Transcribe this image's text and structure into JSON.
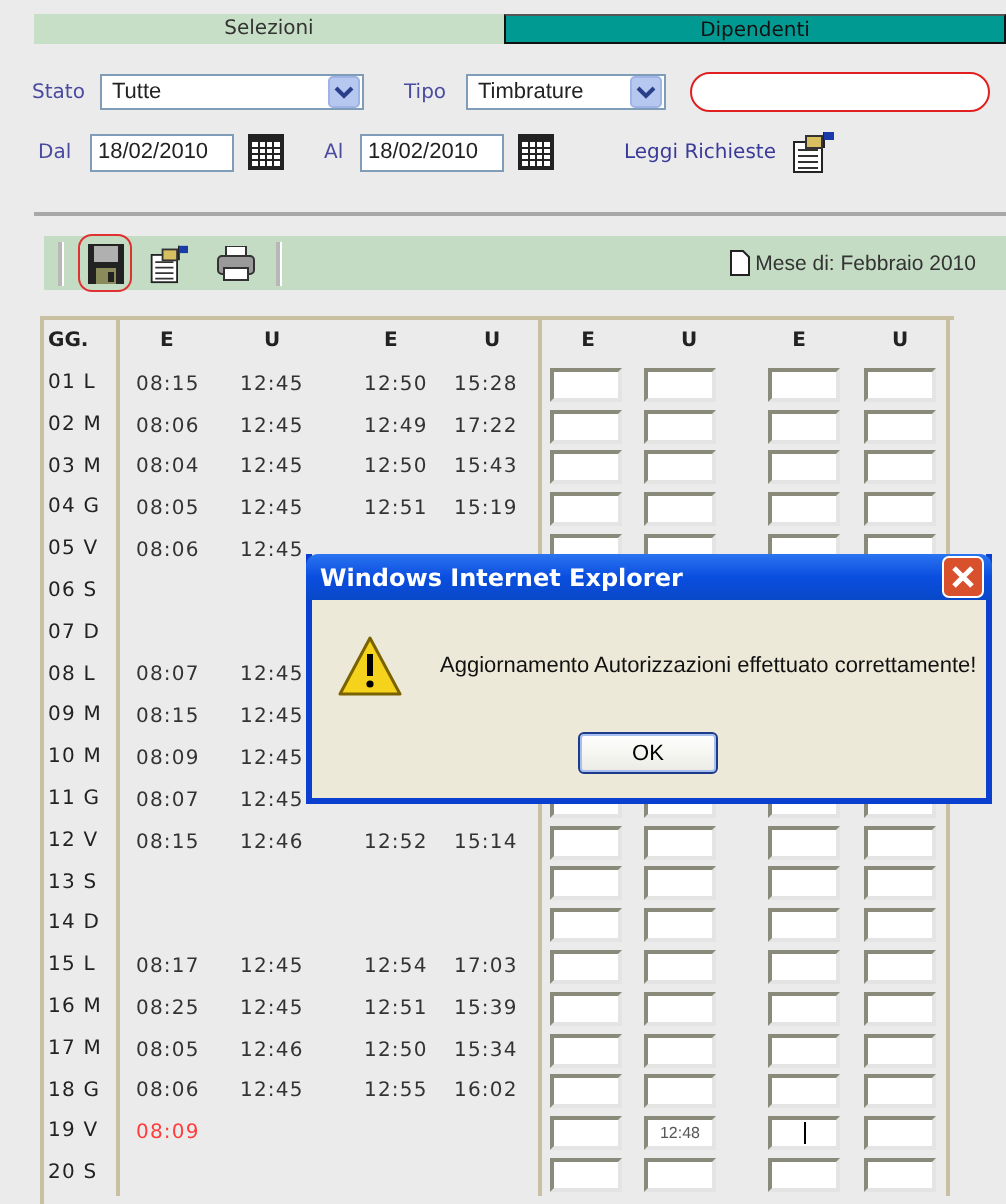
{
  "tabs": [
    {
      "label": "Selezioni",
      "selected": true
    },
    {
      "label": "Dipendenti",
      "selected": false
    }
  ],
  "filters": {
    "stato_label": "Stato",
    "stato_value": "Tutte",
    "tipo_label": "Tipo",
    "tipo_value": "Timbrature",
    "dal_label": "Dal",
    "dal_value": "18/02/2010",
    "al_label": "Al",
    "al_value": "18/02/2010",
    "leggi_link": "Leggi Richieste"
  },
  "toolbar": {
    "month": "Mese di: Febbraio 2010"
  },
  "table": {
    "columns": [
      "GG.",
      "E",
      "U",
      "E",
      "U",
      "E",
      "U",
      "E",
      "U"
    ],
    "rows": [
      {
        "day": "01 L",
        "times": [
          {
            "text": "08:15",
            "late": false
          },
          {
            "text": "12:45",
            "late": false
          },
          {
            "text": "12:50",
            "late": false
          },
          {
            "text": "15:28",
            "late": false
          }
        ],
        "inputs": [
          {
            "focused": false
          },
          {
            "focused": false
          },
          {
            "focused": false
          },
          {
            "focused": false
          }
        ]
      },
      {
        "day": "02 M",
        "times": [
          {
            "text": "08:06",
            "late": false
          },
          {
            "text": "12:45",
            "late": false
          },
          {
            "text": "12:49",
            "late": false
          },
          {
            "text": "17:22",
            "late": false
          }
        ],
        "inputs": [
          {
            "focused": false
          },
          {
            "focused": false
          },
          {
            "focused": false
          },
          {
            "focused": false
          }
        ]
      },
      {
        "day": "03 M",
        "times": [
          {
            "text": "08:04",
            "late": false
          },
          {
            "text": "12:45",
            "late": false
          },
          {
            "text": "12:50",
            "late": false
          },
          {
            "text": "15:43",
            "late": false
          }
        ],
        "inputs": [
          {
            "focused": false
          },
          {
            "focused": false
          },
          {
            "focused": false
          },
          {
            "focused": false
          }
        ]
      },
      {
        "day": "04 G",
        "times": [
          {
            "text": "08:05",
            "late": false
          },
          {
            "text": "12:45",
            "late": false
          },
          {
            "text": "12:51",
            "late": false
          },
          {
            "text": "15:19",
            "late": false
          }
        ],
        "inputs": [
          {
            "focused": false
          },
          {
            "focused": false
          },
          {
            "focused": false
          },
          {
            "focused": false
          }
        ]
      },
      {
        "day": "05 V",
        "times": [
          {
            "text": "08:06",
            "late": false
          },
          {
            "text": "12:45",
            "late": false
          }
        ],
        "inputs": [
          {
            "focused": false
          },
          {
            "focused": false
          },
          {
            "focused": false
          },
          {
            "focused": false
          }
        ]
      },
      {
        "day": "06 S",
        "times": [],
        "inputs": []
      },
      {
        "day": "07 D",
        "times": [],
        "inputs": []
      },
      {
        "day": "08 L",
        "times": [
          {
            "text": "08:07",
            "late": false
          },
          {
            "text": "12:45",
            "late": false
          }
        ],
        "inputs": []
      },
      {
        "day": "09 M",
        "times": [
          {
            "text": "08:15",
            "late": false
          },
          {
            "text": "12:45",
            "late": false
          }
        ],
        "inputs": []
      },
      {
        "day": "10 M",
        "times": [
          {
            "text": "08:09",
            "late": false
          },
          {
            "text": "12:45",
            "late": false
          }
        ],
        "inputs": []
      },
      {
        "day": "11 G",
        "times": [
          {
            "text": "08:07",
            "late": false
          },
          {
            "text": "12:45",
            "late": false
          }
        ],
        "inputs": [
          {
            "focused": false
          },
          {
            "focused": false
          },
          {
            "focused": false
          },
          {
            "focused": false
          }
        ]
      },
      {
        "day": "12 V",
        "times": [
          {
            "text": "08:15",
            "late": false
          },
          {
            "text": "12:46",
            "late": false
          },
          {
            "text": "12:52",
            "late": false
          },
          {
            "text": "15:14",
            "late": false
          }
        ],
        "inputs": [
          {
            "focused": false
          },
          {
            "focused": false
          },
          {
            "focused": false
          },
          {
            "focused": false
          }
        ]
      },
      {
        "day": "13 S",
        "times": [],
        "inputs": [
          {
            "focused": false
          },
          {
            "focused": false
          },
          {
            "focused": false
          },
          {
            "focused": false
          }
        ]
      },
      {
        "day": "14 D",
        "times": [],
        "inputs": [
          {
            "focused": false
          },
          {
            "focused": false
          },
          {
            "focused": false
          },
          {
            "focused": false
          }
        ]
      },
      {
        "day": "15 L",
        "times": [
          {
            "text": "08:17",
            "late": false
          },
          {
            "text": "12:45",
            "late": false
          },
          {
            "text": "12:54",
            "late": false
          },
          {
            "text": "17:03",
            "late": false
          }
        ],
        "inputs": [
          {
            "focused": false
          },
          {
            "focused": false
          },
          {
            "focused": false
          },
          {
            "focused": false
          }
        ]
      },
      {
        "day": "16 M",
        "times": [
          {
            "text": "08:25",
            "late": false
          },
          {
            "text": "12:45",
            "late": false
          },
          {
            "text": "12:51",
            "late": false
          },
          {
            "text": "15:39",
            "late": false
          }
        ],
        "inputs": [
          {
            "focused": false
          },
          {
            "focused": false
          },
          {
            "focused": false
          },
          {
            "focused": false
          }
        ]
      },
      {
        "day": "17 M",
        "times": [
          {
            "text": "08:05",
            "late": false
          },
          {
            "text": "12:46",
            "late": false
          },
          {
            "text": "12:50",
            "late": false
          },
          {
            "text": "15:34",
            "late": false
          }
        ],
        "inputs": [
          {
            "focused": false
          },
          {
            "focused": false
          },
          {
            "focused": false
          },
          {
            "focused": false
          }
        ]
      },
      {
        "day": "18 G",
        "times": [
          {
            "text": "08:06",
            "late": false
          },
          {
            "text": "12:45",
            "late": false
          },
          {
            "text": "12:55",
            "late": false
          },
          {
            "text": "16:02",
            "late": false
          }
        ],
        "inputs": [
          {
            "focused": false
          },
          {
            "focused": false
          },
          {
            "focused": false
          },
          {
            "focused": false
          }
        ]
      },
      {
        "day": "19 V",
        "times": [
          {
            "text": "08:09",
            "late": true
          }
        ],
        "inputs": [
          {
            "focused": false
          },
          {
            "focused": false,
            "value": "12:48"
          },
          {
            "focused": true
          },
          {
            "focused": false
          }
        ]
      },
      {
        "day": "20 S",
        "times": [],
        "inputs": [
          {
            "focused": false
          },
          {
            "focused": false
          },
          {
            "focused": false
          },
          {
            "focused": false
          }
        ]
      }
    ]
  },
  "dialog": {
    "title": "Windows Internet Explorer",
    "message": "Aggiornamento Autorizzazioni effettuato correttamente!",
    "button": "OK"
  }
}
